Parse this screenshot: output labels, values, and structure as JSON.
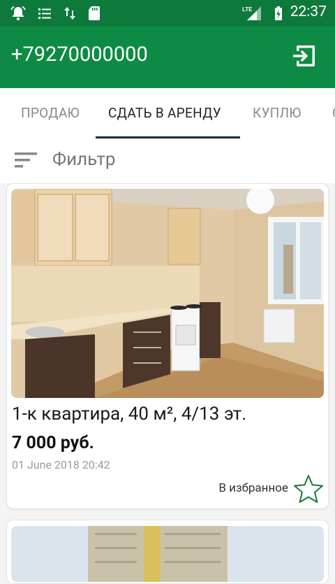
{
  "status_bar": {
    "time": "22:37",
    "network_label": "LTE",
    "icons": [
      "alarm-icon",
      "notification-list-icon",
      "data-transfer-icon",
      "sd-card-icon",
      "signal-icon",
      "battery-charging-icon"
    ]
  },
  "app_bar": {
    "phone": "+79270000000",
    "action_icon": "logout-icon"
  },
  "tabs": [
    {
      "label": "ПРОДАЮ",
      "active": false
    },
    {
      "label": "СДАТЬ В АРЕНДУ",
      "active": true
    },
    {
      "label": "КУПЛЮ",
      "active": false
    }
  ],
  "filter": {
    "label": "Фильтр",
    "icon": "sort-filter-icon"
  },
  "listings": [
    {
      "title": "1-к квартира, 40 м², 4/13 эт.",
      "price": "7 000 руб.",
      "date": "01 June 2018 20:42",
      "favorite_label": "В избранное",
      "favorite_icon": "star-outline-icon"
    }
  ],
  "colors": {
    "status_bar": "#0d7a3c",
    "app_bar": "#0d8b45",
    "tab_indicator": "#0b2d42",
    "star": "#1a7a3a"
  }
}
